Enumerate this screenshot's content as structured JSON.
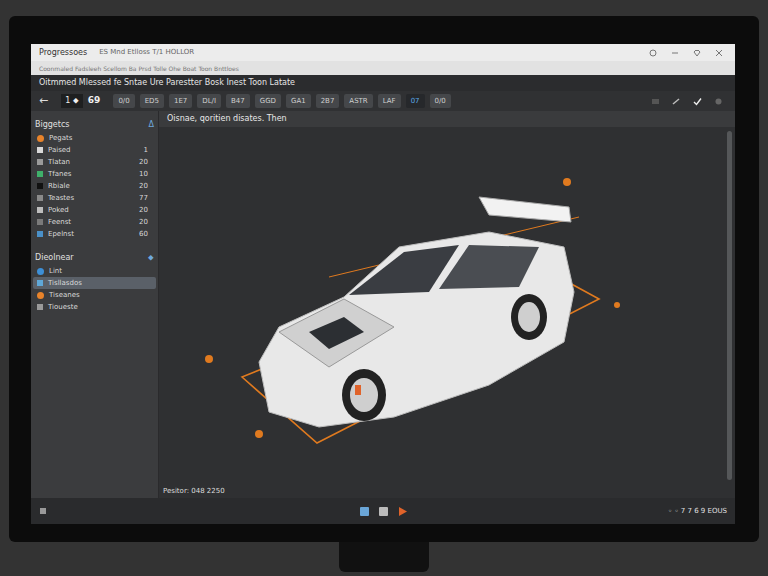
{
  "window": {
    "title": "Progressoes",
    "menu": "ES Mnd Etlloss    T/1 HOLLOR"
  },
  "subtitle": "Coonmaled   Fadsleeh Scellom Ba Prsd Tolle Ohe Boat Toon Bnttloes",
  "heading": "Oitmmed Mlessed fe Sntae Ure Parestter Bosk Inest Toon Latate",
  "toolbar": {
    "back": "←",
    "page": "1 ⬥",
    "count": "69",
    "buttons": [
      {
        "label": "0/0",
        "selected": false
      },
      {
        "label": "ED5",
        "selected": false
      },
      {
        "label": "1E7",
        "selected": false
      },
      {
        "label": "DL/I",
        "selected": false
      },
      {
        "label": "B47",
        "selected": false
      },
      {
        "label": "GGD",
        "selected": false
      },
      {
        "label": "GA1",
        "selected": false
      },
      {
        "label": "2B7",
        "selected": false
      },
      {
        "label": "ASTR",
        "selected": false
      },
      {
        "label": "LAF",
        "selected": false
      },
      {
        "label": "07",
        "selected": true
      },
      {
        "label": "0/0",
        "selected": false
      }
    ]
  },
  "sidebar": {
    "sections": [
      {
        "title": "Biggetcs",
        "icon": "Δ",
        "items": [
          {
            "label": "Pegats",
            "count": "",
            "color": "#e8832a",
            "selected": false
          },
          {
            "label": "Paised",
            "count": "1",
            "color": "#d9d9d9",
            "selected": false
          },
          {
            "label": "Tlatan",
            "count": "20",
            "color": "#9a9a9a",
            "selected": false
          },
          {
            "label": "Tfanes",
            "count": "10",
            "color": "#3fb06a",
            "selected": false
          },
          {
            "label": "Rbiale",
            "count": "20",
            "color": "#111111",
            "selected": false
          },
          {
            "label": "Teastes",
            "count": "77",
            "color": "#8a8a8a",
            "selected": false
          },
          {
            "label": "Poked",
            "count": "20",
            "color": "#bdbdbd",
            "selected": false
          },
          {
            "label": "Feenst",
            "count": "20",
            "color": "#7a7a7a",
            "selected": false
          },
          {
            "label": "Epelnst",
            "count": "60",
            "color": "#4a90c8",
            "selected": false
          }
        ]
      },
      {
        "title": "Dieolnear",
        "icon": "⬥",
        "items": [
          {
            "label": "Lint",
            "count": "",
            "color": "#3d8fd6",
            "selected": false
          },
          {
            "label": "Tisllasdos",
            "count": "",
            "color": "#5fa8d8",
            "selected": true
          },
          {
            "label": "Tiseanes",
            "count": "",
            "color": "#e8832a",
            "selected": false
          },
          {
            "label": "Tioueste",
            "count": "",
            "color": "#9a9a9a",
            "selected": false
          }
        ]
      }
    ]
  },
  "viewport": {
    "caption": "Oisnae, qoritien disates. Then",
    "footer": "Pesitor: 048 2250"
  },
  "taskbar": {
    "tray": "◦ ◦ 7 7 6 9 EOUS"
  }
}
